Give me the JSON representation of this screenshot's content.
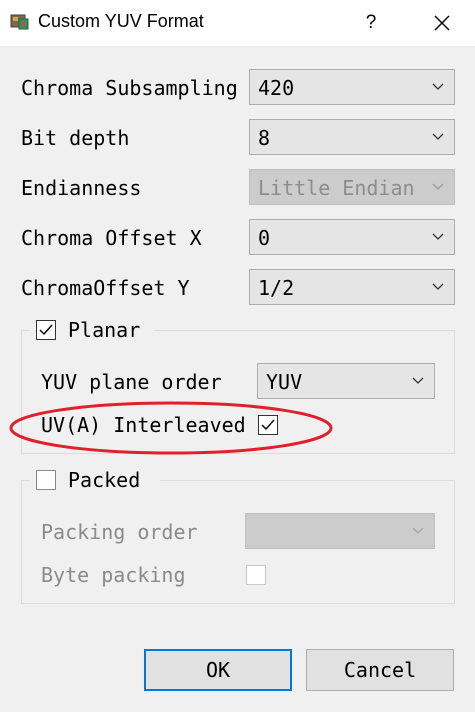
{
  "window": {
    "title": "Custom YUV Format",
    "help_label": "?",
    "app_icon": "app-icon",
    "close_icon": "close-icon"
  },
  "form": {
    "chroma_subsampling": {
      "label": "Chroma Subsampling",
      "value": "420"
    },
    "bit_depth": {
      "label": "Bit depth",
      "value": "8"
    },
    "endianness": {
      "label": "Endianness",
      "value": "Little Endian",
      "enabled": false
    },
    "chroma_offset_x": {
      "label": "Chroma Offset X",
      "value": "0"
    },
    "chroma_offset_y": {
      "label": "ChromaOffset Y",
      "value": "1/2"
    }
  },
  "planar": {
    "title": "Planar",
    "checked": true,
    "yuv_plane_order": {
      "label": "YUV plane order",
      "value": "YUV"
    },
    "uv_interleaved": {
      "label": "UV(A) Interleaved",
      "checked": true
    }
  },
  "packed": {
    "title": "Packed",
    "checked": false,
    "packing_order": {
      "label": "Packing order",
      "value": "",
      "enabled": false
    },
    "byte_packing": {
      "label": "Byte packing",
      "checked": false,
      "enabled": false
    }
  },
  "buttons": {
    "ok": "OK",
    "cancel": "Cancel"
  },
  "annotation": {
    "shape": "ellipse",
    "color": "#e0202a"
  },
  "colors": {
    "dialog_bg": "#f0f0f0",
    "accent": "#0078d7",
    "disabled_text": "#8a8a8a"
  }
}
